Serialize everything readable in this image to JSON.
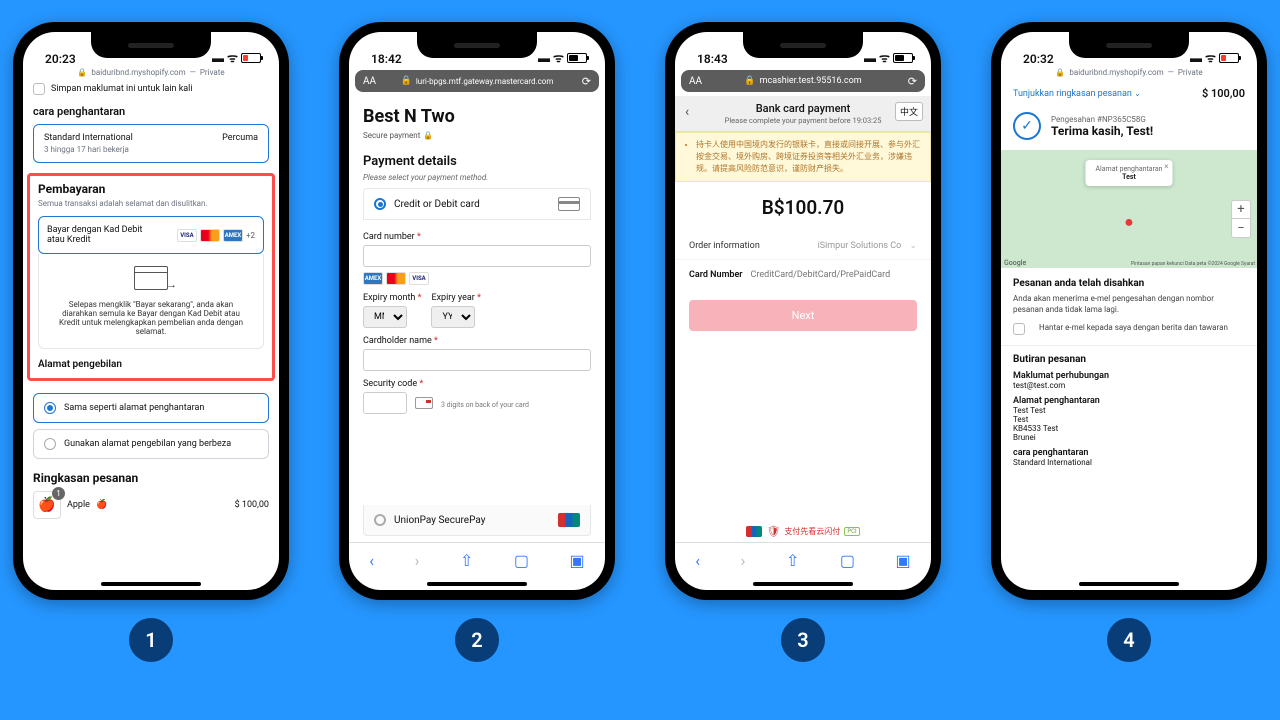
{
  "steps": [
    "1",
    "2",
    "3",
    "4"
  ],
  "phone1": {
    "time": "20:23",
    "url": "baiduribnd.myshopify.com",
    "private": "Private",
    "save_info": "Simpan maklumat ini untuk lain kali",
    "shipping_title": "cara penghantaran",
    "ship_name": "Standard International",
    "ship_eta": "3 hingga 17 hari bekerja",
    "ship_price": "Percuma",
    "pay_title": "Pembayaran",
    "pay_desc": "Semua transaksi adalah selamat dan disulitkan.",
    "pay_method": "Bayar dengan Kad Debit atau Kredit",
    "plus2": "+2",
    "redirect_text": "Selepas mengklik \"Bayar sekarang\", anda akan diarahkan semula ke Bayar dengan Kad Debit atau Kredit untuk melengkapkan pembelian anda dengan selamat.",
    "billing_title": "Alamat pengebilan",
    "billing_same": "Sama seperti alamat penghantaran",
    "billing_diff": "Gunakan alamat pengebilan yang berbeza",
    "summary_title": "Ringkasan pesanan",
    "item_name": "Apple",
    "item_qty": "1",
    "item_price": "$ 100,00"
  },
  "phone2": {
    "time": "18:42",
    "url": "luri-bpgs.mtf.gateway.mastercard.com",
    "merchant": "Best N Two",
    "secure": "Secure payment",
    "section": "Payment details",
    "hint": "Please select your payment method.",
    "opt_card": "Credit or Debit card",
    "opt_unionpay": "UnionPay SecurePay",
    "card_number": "Card number",
    "expiry_month": "Expiry month",
    "expiry_year": "Expiry year",
    "mm": "MM",
    "yy": "YY",
    "cardholder": "Cardholder name",
    "security": "Security code",
    "sec_hint": "3 digits on back of your card"
  },
  "phone3": {
    "time": "18:43",
    "url": "mcashier.test.95516.com",
    "lang": "中文",
    "title": "Bank card payment",
    "subtitle": "Please complete your payment before 19:03:25",
    "warning": "持卡人使用中国境内发行的银联卡，直接或间接开展、参与外汇按金交易、境外购房、跨境证券投资等相关外汇业务，涉嫌违规。请提高风险防范意识，谨防财产损失。",
    "amount": "B$100.70",
    "order_info": "Order information",
    "merchant": "iSimpur Solutions Co",
    "card_number": "Card Number",
    "card_placeholder": "CreditCard/DebitCard/PrePaidCard",
    "next": "Next",
    "footer_brand": "支付先看云闪付",
    "pci": "PCI"
  },
  "phone4": {
    "time": "20:32",
    "url": "baiduribnd.myshopify.com",
    "private": "Private",
    "show_summary": "Tunjukkan ringkasan pesanan",
    "total": "$ 100,00",
    "order_no": "Pengesahan #NP365C58G",
    "thanks": "Terima kasih, Test!",
    "map_popup_title": "Alamat penghantaran",
    "map_popup_value": "Test",
    "map_attr": "Pintasan papan kekunci   Data peta ©2024 Google   Syarat",
    "map_google": "Google",
    "confirmed_title": "Pesanan anda telah disahkan",
    "confirmed_desc": "Anda akan menerima e-mel pengesahan dengan nombor pesanan anda tidak lama lagi.",
    "email_opt": "Hantar e-mel kepada saya dengan berita dan tawaran",
    "details_title": "Butiran pesanan",
    "contact_label": "Maklumat perhubungan",
    "contact_value": "test@test.com",
    "ship_addr_label": "Alamat penghantaran",
    "ship_line1": "Test Test",
    "ship_line2": "Test",
    "ship_line3": "KB4533 Test",
    "ship_line4": "Brunei",
    "ship_method_label": "cara penghantaran",
    "ship_method_value": "Standard International"
  }
}
